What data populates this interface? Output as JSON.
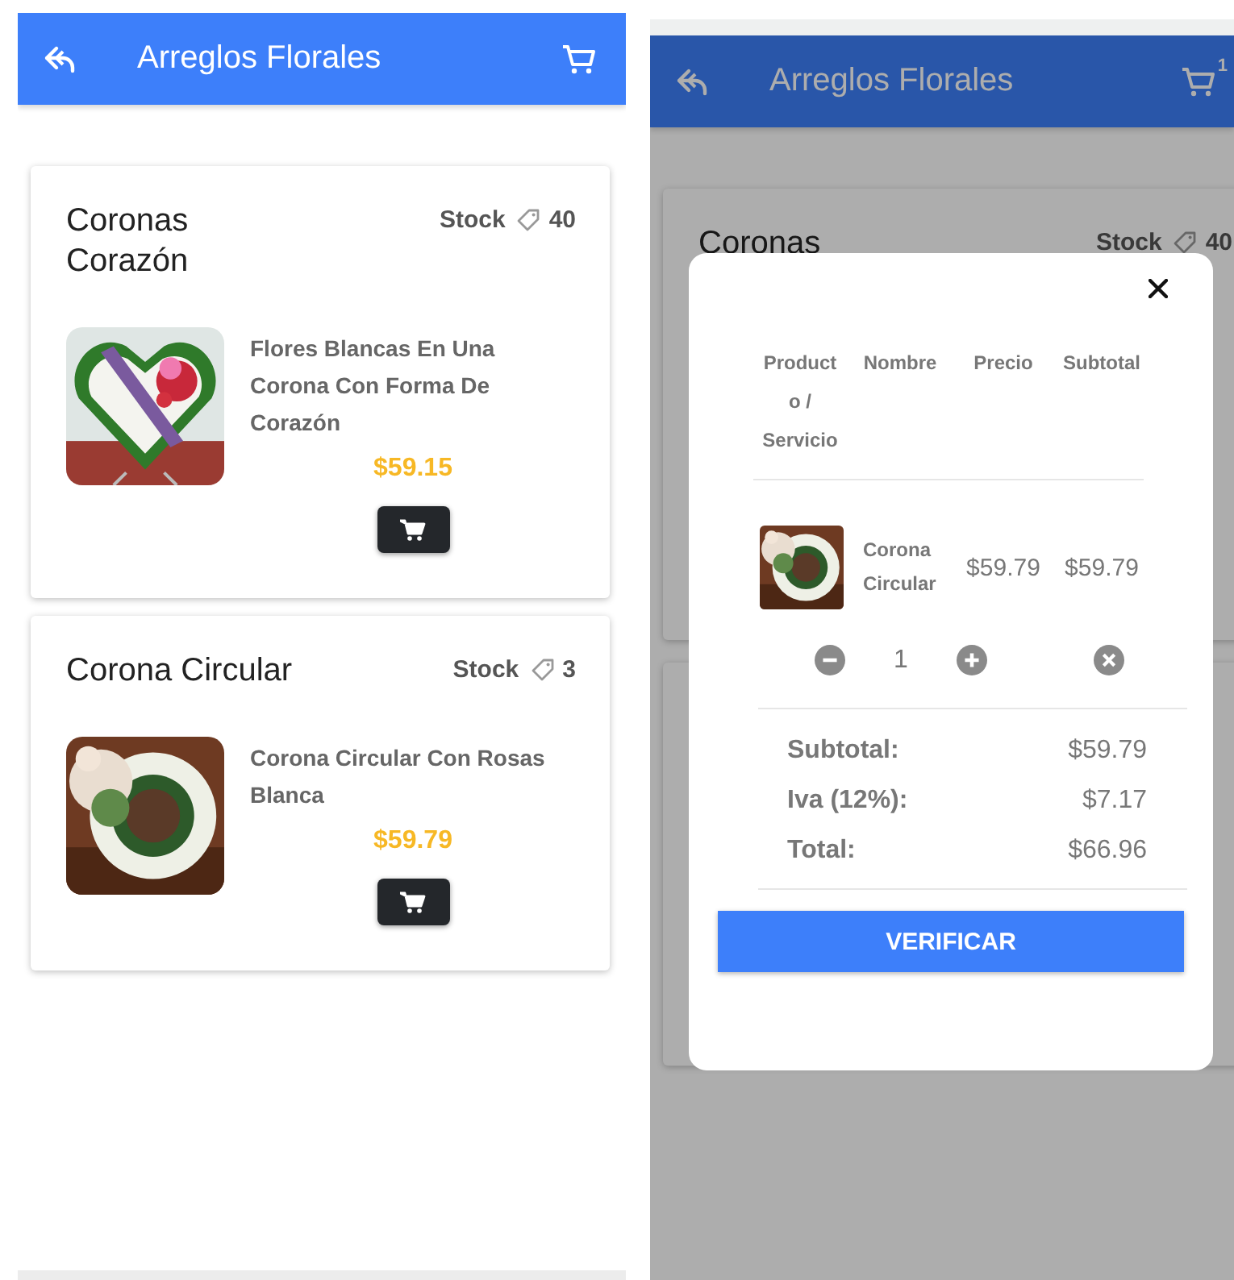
{
  "catalog_screen": {
    "header": {
      "title": "Arreglos Florales"
    },
    "products": [
      {
        "title": "Coronas Corazón",
        "stock_label": "Stock",
        "stock": "40",
        "description": "Flores Blancas En Una Corona Con Forma De Corazón",
        "price": "$59.15"
      },
      {
        "title": "Corona Circular",
        "stock_label": "Stock",
        "stock": "3",
        "description": "Corona Circular Con Rosas Blanca",
        "price": "$59.79"
      }
    ]
  },
  "cart_screen": {
    "header": {
      "title": "Arreglos Florales",
      "cart_badge": "1"
    },
    "background_card": {
      "title": "Coronas",
      "stock_label": "Stock",
      "stock": "40"
    },
    "cart_modal": {
      "columns": [
        "Producto / Servicio",
        "Nombre",
        "Precio",
        "Subtotal"
      ],
      "items": [
        {
          "name": "Corona Circular",
          "price": "$59.79",
          "subtotal": "$59.79",
          "quantity": "1"
        }
      ],
      "summary": [
        {
          "label": "Subtotal:",
          "value": "$59.79"
        },
        {
          "label": "Iva (12%):",
          "value": "$7.17"
        },
        {
          "label": "Total:",
          "value": "$66.96"
        }
      ],
      "checkout_button": "VERIFICAR"
    }
  }
}
